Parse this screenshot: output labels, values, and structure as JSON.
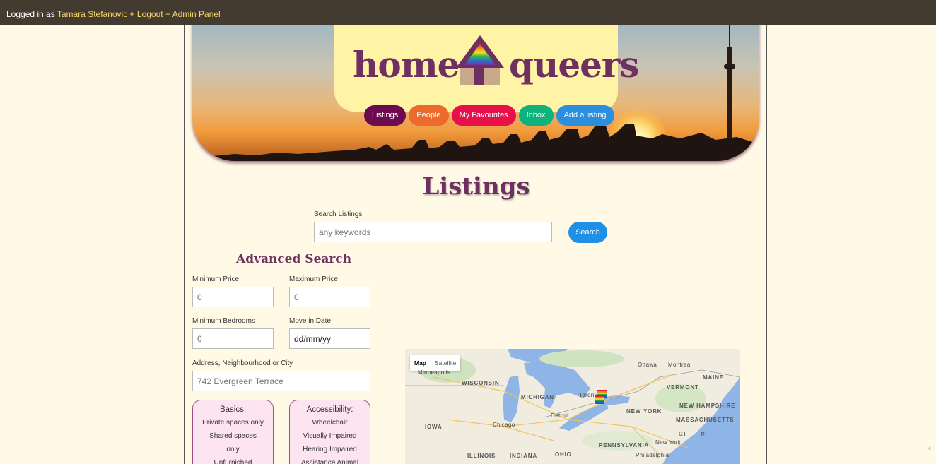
{
  "topbar": {
    "logged_in_prefix": "Logged in as ",
    "user_link": "Tamara Stefanovic + Logout + Admin Panel"
  },
  "logo": {
    "left": "homes",
    "right": "queers"
  },
  "nav": [
    {
      "label": "Listings",
      "color": "#6e0a4f"
    },
    {
      "label": "People",
      "color": "#ec6a2c"
    },
    {
      "label": "My Favourites",
      "color": "#e8104a"
    },
    {
      "label": "Inbox",
      "color": "#0db37b"
    },
    {
      "label": "Add a listing",
      "color": "#2b8fe0"
    }
  ],
  "page_title": "Listings",
  "search": {
    "label": "Search Listings",
    "placeholder": "any keywords",
    "button": "Search"
  },
  "advanced": {
    "title": "Advanced Search",
    "min_price_label": "Minimum Price",
    "min_price_placeholder": "0",
    "max_price_label": "Maximum Price",
    "max_price_placeholder": "0",
    "min_bed_label": "Minimum Bedrooms",
    "min_bed_placeholder": "0",
    "move_in_label": "Move in Date",
    "move_in_value": "dd/mm/yy",
    "address_label": "Address, Neighbourhood or City",
    "address_placeholder": "742 Evergreen Terrace",
    "basics": {
      "title": "Basics:",
      "options": [
        "Private spaces only",
        "Shared spaces",
        "only",
        "Unfurnished"
      ]
    },
    "accessibility": {
      "title": "Accessibility:",
      "options": [
        "Wheelchair",
        "Visually Impaired",
        "Hearing Impaired",
        "Assistance Animal"
      ]
    }
  },
  "map": {
    "tab_map": "Map",
    "tab_satellite": "Satellite",
    "labels": {
      "minneapolis": "Minneapolis",
      "wisconsin": "WISCONSIN",
      "michigan": "MICHIGAN",
      "toronto": "Toronto",
      "ottawa": "Ottawa",
      "montreal": "Montreal",
      "maine": "MAINE",
      "vermont": "VERMONT",
      "new_hampshire": "NEW\nHAMPSHIRE",
      "new_york": "NEW YORK",
      "massachusetts": "MASSACHUSETTS",
      "detroit": "Detroit",
      "chicago": "Chicago",
      "iowa": "IOWA",
      "illinois": "ILLINOIS",
      "indiana": "INDIANA",
      "ohio": "OHIO",
      "pennsylvania": "PENNSYLVANIA",
      "new_york_city": "New York",
      "philadelphia": "Philadelphia",
      "ct": "CT",
      "ri": "RI"
    }
  }
}
